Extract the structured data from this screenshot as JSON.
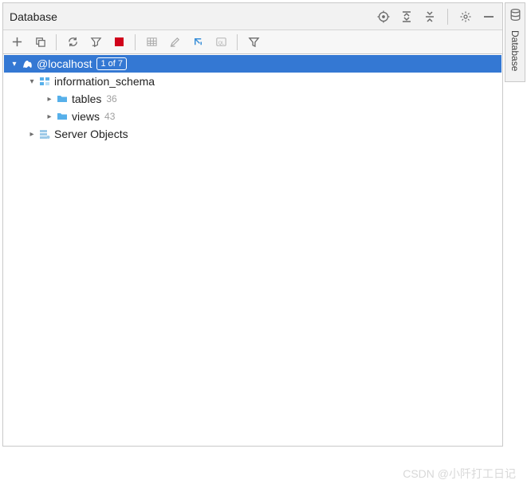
{
  "panel": {
    "title": "Database"
  },
  "sideTab": {
    "label": "Database"
  },
  "tree": {
    "root": {
      "label": "@localhost",
      "badge": "1 of 7"
    },
    "schema": {
      "label": "information_schema"
    },
    "tables": {
      "label": "tables",
      "count": "36"
    },
    "views": {
      "label": "views",
      "count": "43"
    },
    "serverObjects": {
      "label": "Server Objects"
    }
  },
  "watermark": "CSDN @小阡打工日记"
}
